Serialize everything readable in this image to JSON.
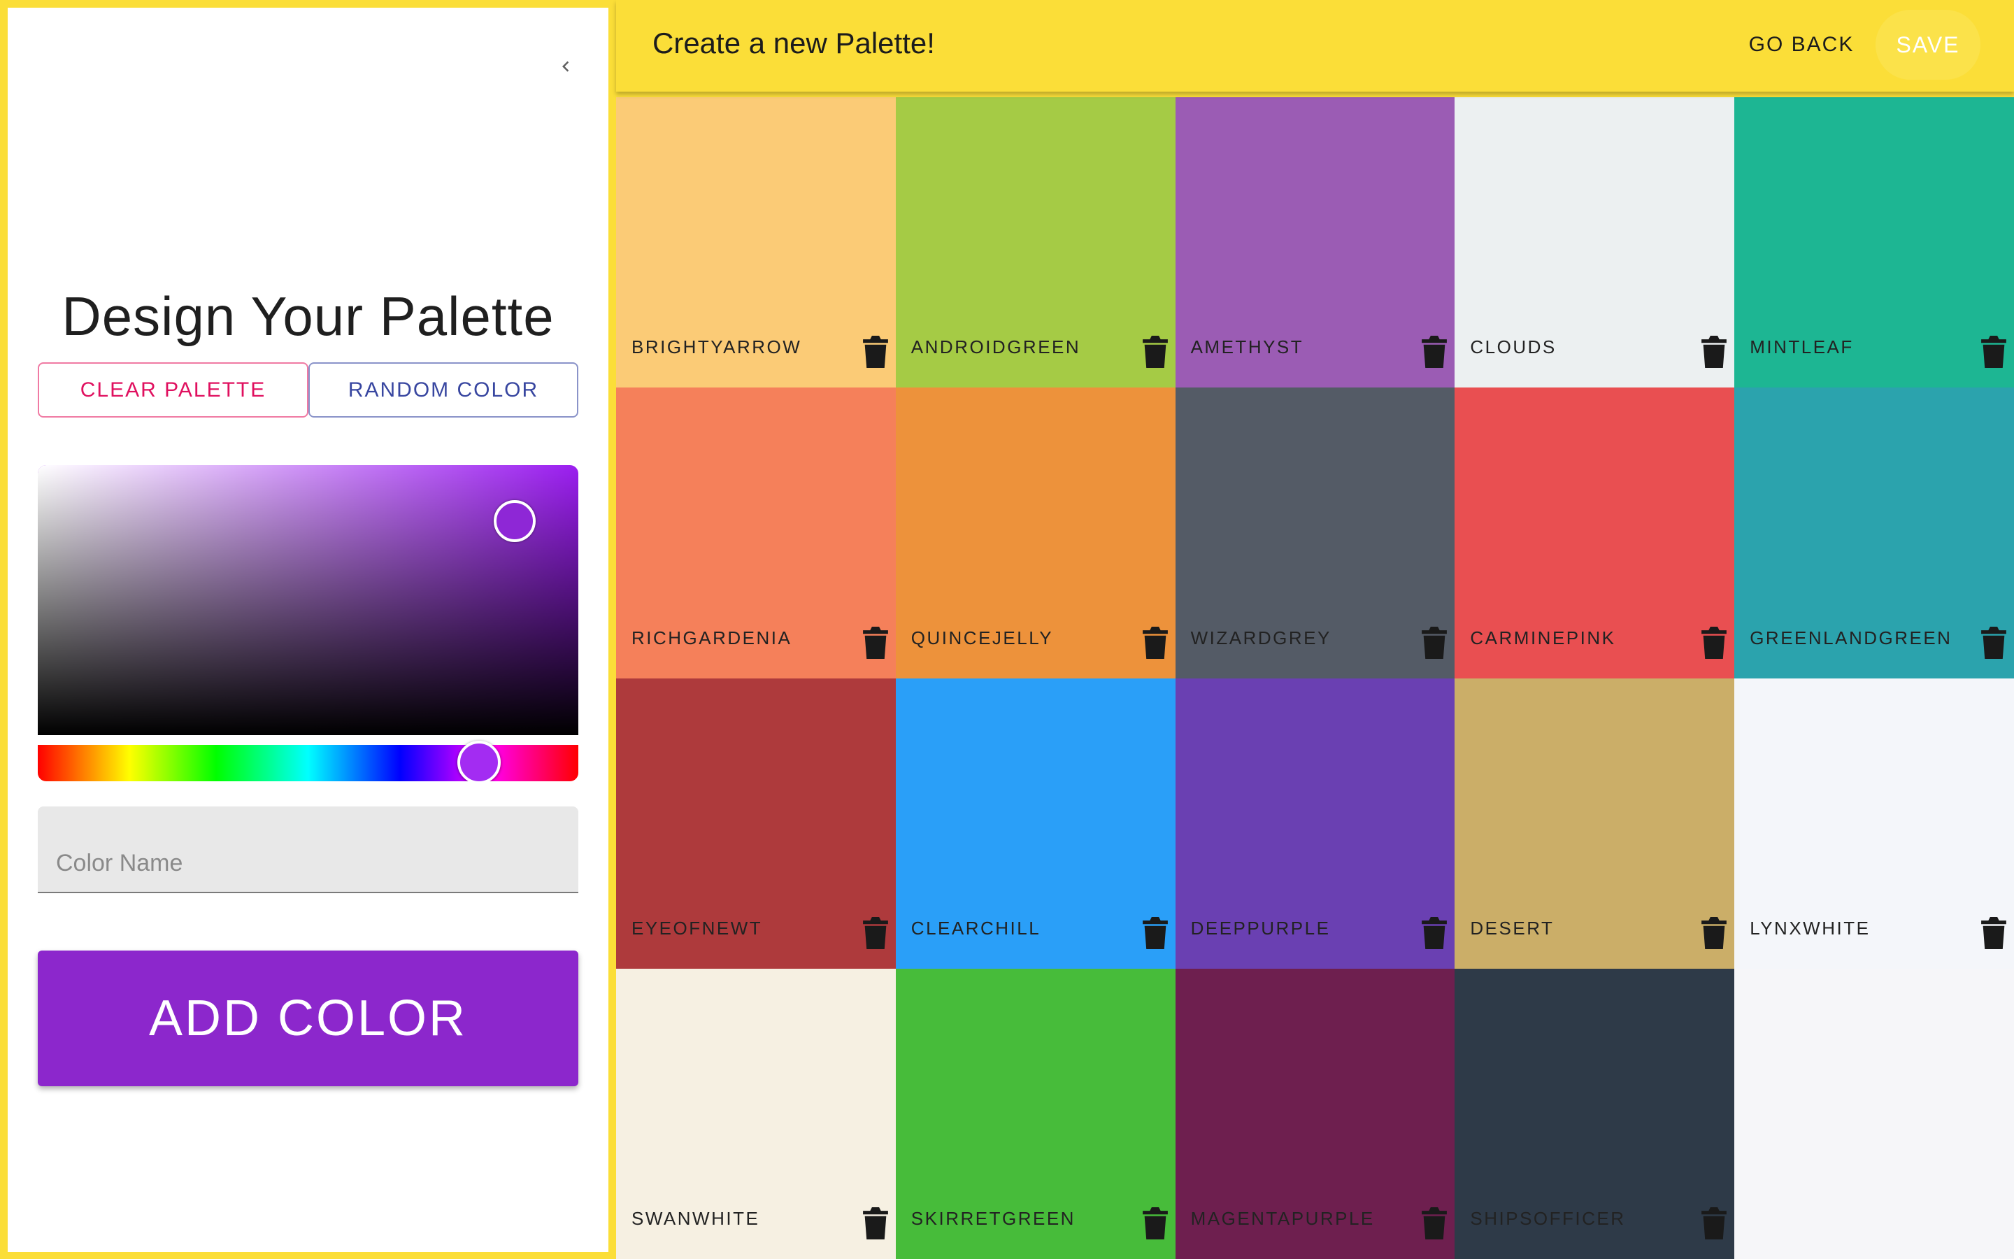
{
  "drawer": {
    "title": "Design Your Palette",
    "clear_label": "CLEAR PALETTE",
    "random_label": "RANDOM COLOR",
    "color_name_placeholder": "Color Name",
    "color_name_value": "",
    "add_label": "ADD COLOR",
    "current_color": "#8e27d6"
  },
  "appbar": {
    "title": "Create a new Palette!",
    "go_back_label": "GO BACK",
    "save_label": "SAVE"
  },
  "colors": [
    {
      "name": "brightyarrow",
      "color": "#fbcb76",
      "text": "#222222"
    },
    {
      "name": "androidgreen",
      "color": "#a5cb45",
      "text": "#222222"
    },
    {
      "name": "amethyst",
      "color": "#9b5cb4",
      "text": "#222222"
    },
    {
      "name": "clouds",
      "color": "#ecf0f1",
      "text": "#222222"
    },
    {
      "name": "mintleaf",
      "color": "#1db693",
      "text": "#222222"
    },
    {
      "name": "richgardenia",
      "color": "#f5805a",
      "text": "#222222"
    },
    {
      "name": "quincejelly",
      "color": "#ed923b",
      "text": "#222222"
    },
    {
      "name": "wizardgrey",
      "color": "#545b66",
      "text": "#222222"
    },
    {
      "name": "carminepink",
      "color": "#e94f51",
      "text": "#222222"
    },
    {
      "name": "greenlandgreen",
      "color": "#2ba3ad",
      "text": "#222222"
    },
    {
      "name": "eyeofnewt",
      "color": "#ae3a3c",
      "text": "#222222"
    },
    {
      "name": "clearchill",
      "color": "#2a9ff8",
      "text": "#222222"
    },
    {
      "name": "deeppurple",
      "color": "#6a40b2",
      "text": "#222222"
    },
    {
      "name": "desert",
      "color": "#cbae68",
      "text": "#222222"
    },
    {
      "name": "lynxwhite",
      "color": "#f4f6fa",
      "text": "#222222"
    },
    {
      "name": "swanwhite",
      "color": "#f6f0e2",
      "text": "#222222"
    },
    {
      "name": "skirretgreen",
      "color": "#47bc3a",
      "text": "#222222"
    },
    {
      "name": "magentapurple",
      "color": "#6e1f4f",
      "text": "#222222"
    },
    {
      "name": "shipsofficer",
      "color": "#2e3a48",
      "text": "#222222"
    }
  ]
}
